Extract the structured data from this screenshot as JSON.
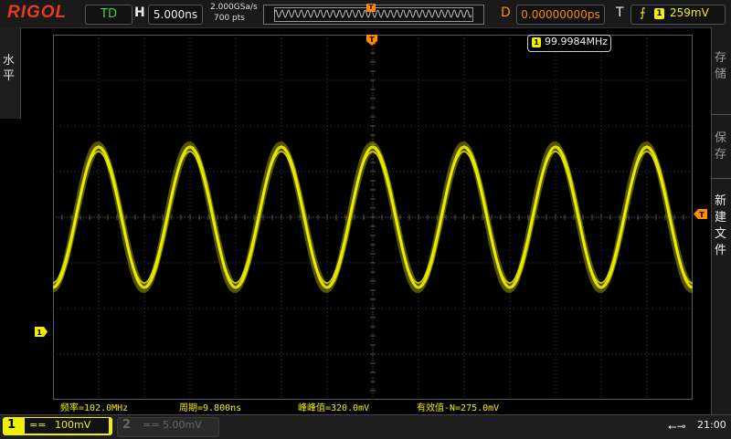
{
  "header": {
    "logo": "RIGOL",
    "run_status": "TD",
    "h_label": "H",
    "timebase": "5.000ns",
    "sample_rate": "2.000GSa/s",
    "memory_depth": "700 pts",
    "delay_label": "D",
    "delay": "0.00000000ps",
    "trigger_label": "T",
    "trigger_source": "1",
    "trigger_level": "259mV",
    "trigger_edge_icon": "rising-edge-icon"
  },
  "left_menu": {
    "label": "水平"
  },
  "right_menu": {
    "items": [
      {
        "label": "存储",
        "active": false
      },
      {
        "label": "保存",
        "active": false
      },
      {
        "label": "新建文件",
        "active": true
      }
    ]
  },
  "display": {
    "frequency_counter": "99.9984MHz",
    "frequency_source": "1",
    "trigger_position_marker": "T",
    "trigger_level_marker": "T",
    "ch1_marker": "1",
    "waveform": {
      "cycles_visible": 7,
      "color": "#f0f000"
    }
  },
  "measurements": [
    {
      "label": "频率=102.0MHz"
    },
    {
      "label": "周期=9.800ns"
    },
    {
      "label": "峰峰值=320.0mV"
    },
    {
      "label": "有效值-N=275.0mV"
    }
  ],
  "channels": [
    {
      "number": "1",
      "coupling": "==",
      "scale": "100mV",
      "active": true
    },
    {
      "number": "2",
      "coupling": "==",
      "scale": "5.00mV",
      "active": false
    }
  ],
  "status": {
    "clock": "21:00",
    "usb_icon": "usb-icon"
  },
  "colors": {
    "ch1": "#f0f000",
    "trigger": "#ff8a00",
    "logo": "#e53a1f",
    "run": "#3cd43c"
  }
}
